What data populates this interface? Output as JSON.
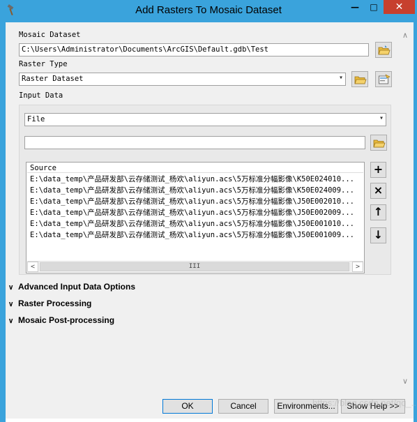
{
  "window": {
    "title": "Add Rasters To Mosaic Dataset",
    "minimize_glyph": "—",
    "maximize_glyph": "□",
    "close_glyph": "✕",
    "icon": "hammer-icon"
  },
  "form": {
    "mosaic_dataset_label": "Mosaic Dataset",
    "mosaic_dataset_value": "C:\\Users\\Administrator\\Documents\\ArcGIS\\Default.gdb\\Test",
    "raster_type_label": "Raster Type",
    "raster_type_value": "Raster Dataset",
    "input_data_label": "Input Data",
    "input_data_type": "File",
    "input_path_value": ""
  },
  "source_list": {
    "header": "Source",
    "rows": [
      "E:\\data_temp\\产品研发部\\云存储测试_杨欢\\aliyun.acs\\5万标准分幅影像\\K50E024010...",
      "E:\\data_temp\\产品研发部\\云存储测试_杨欢\\aliyun.acs\\5万标准分幅影像\\K50E024009...",
      "E:\\data_temp\\产品研发部\\云存储测试_杨欢\\aliyun.acs\\5万标准分幅影像\\J50E002010...",
      "E:\\data_temp\\产品研发部\\云存储测试_杨欢\\aliyun.acs\\5万标准分幅影像\\J50E002009...",
      "E:\\data_temp\\产品研发部\\云存储测试_杨欢\\aliyun.acs\\5万标准分幅影像\\J50E001010...",
      "E:\\data_temp\\产品研发部\\云存储测试_杨欢\\aliyun.acs\\5万标准分幅影像\\J50E001009..."
    ],
    "scroll_left": "<",
    "scroll_right": ">",
    "scroll_thumb": "III"
  },
  "list_buttons": {
    "add": "+",
    "remove": "×",
    "up": "↑",
    "down": "↓"
  },
  "sections": {
    "advanced_input": "Advanced Input Data Options",
    "raster_processing": "Raster Processing",
    "mosaic_post": "Mosaic Post-processing"
  },
  "buttons": {
    "ok": "OK",
    "cancel": "Cancel",
    "environments": "Environments...",
    "show_help": "Show Help >>"
  },
  "watermark": "https://blog.csdn.net/qq_...",
  "colors": {
    "titlebar": "#3aa3dc",
    "close": "#c7402e",
    "folder": "#e8b93b"
  }
}
